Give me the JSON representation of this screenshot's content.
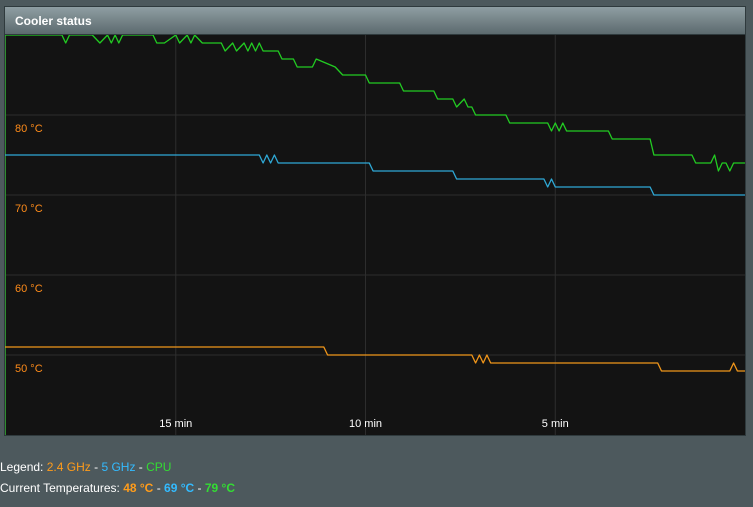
{
  "panel": {
    "title": "Cooler status"
  },
  "legend": {
    "label": "Legend:",
    "sep": "-",
    "items": [
      "2.4 GHz",
      "5 GHz",
      "CPU"
    ]
  },
  "current": {
    "label": "Current Temperatures:",
    "sep": "-",
    "values": [
      "48 °C",
      "69 °C",
      "79 °C"
    ]
  },
  "colors": {
    "ghz24": "#f0961a",
    "ghz5": "#2fa9d6",
    "cpu": "#22cc22",
    "grid": "#2e2e2e",
    "axis_label": "#ff8c1a"
  },
  "chart_data": {
    "type": "line",
    "y_ticks": [
      "80 °C",
      "70 °C",
      "60 °C",
      "50 °C"
    ],
    "y_tick_values": [
      80,
      70,
      60,
      50
    ],
    "x_ticks": [
      "15 min",
      "10 min",
      "5 min"
    ],
    "x_tick_values": [
      -15,
      -10,
      -5
    ],
    "xlim": [
      -19.5,
      0
    ],
    "ylim": [
      40,
      90
    ],
    "series": [
      {
        "name": "CPU",
        "color": "#22cc22",
        "x": [
          -19.5,
          -18.0,
          -17.9,
          -17.8,
          -17.6,
          -17.2,
          -17.0,
          -16.8,
          -16.7,
          -16.6,
          -16.5,
          -16.4,
          -16.3,
          -16.2,
          -15.7,
          -15.6,
          -15.5,
          -15.3,
          -15.0,
          -14.9,
          -14.7,
          -14.6,
          -14.5,
          -14.3,
          -14.2,
          -14.1,
          -13.9,
          -13.8,
          -13.7,
          -13.5,
          -13.4,
          -13.2,
          -13.1,
          -13.0,
          -12.9,
          -12.8,
          -12.7,
          -12.6,
          -12.4,
          -12.3,
          -12.2,
          -12.1,
          -11.9,
          -11.8,
          -11.4,
          -11.3,
          -10.8,
          -10.6,
          -10.0,
          -9.9,
          -9.1,
          -9.0,
          -8.2,
          -8.1,
          -7.7,
          -7.6,
          -7.4,
          -7.3,
          -7.2,
          -7.1,
          -6.3,
          -6.2,
          -5.2,
          -5.1,
          -5.0,
          -4.9,
          -4.8,
          -4.7,
          -3.6,
          -3.5,
          -2.5,
          -2.4,
          -1.4,
          -1.3,
          -0.9,
          -0.8,
          -0.7,
          -0.6,
          -0.5,
          -0.4,
          -0.3,
          -0.2,
          0
        ],
        "y": [
          90,
          90,
          89,
          90,
          90,
          90,
          89,
          90,
          89,
          90,
          89,
          90,
          90,
          90,
          90,
          90,
          89,
          89,
          90,
          89,
          90,
          89,
          90,
          89,
          89,
          89,
          89,
          89,
          88,
          89,
          88,
          89,
          88,
          89,
          88,
          89,
          88,
          88,
          88,
          88,
          87,
          87,
          87,
          86,
          86,
          87,
          86,
          85,
          85,
          84,
          84,
          83,
          83,
          82,
          82,
          81,
          82,
          81,
          81,
          80,
          80,
          79,
          79,
          78,
          79,
          78,
          79,
          78,
          78,
          77,
          77,
          75,
          75,
          74,
          74,
          75,
          73,
          74,
          74,
          73,
          74,
          74,
          74
        ]
      },
      {
        "name": "5 GHz",
        "color": "#2fa9d6",
        "x": [
          -19.5,
          -12.8,
          -12.7,
          -12.6,
          -12.5,
          -12.4,
          -12.3,
          -12.2,
          -9.9,
          -9.8,
          -7.7,
          -7.6,
          -5.3,
          -5.2,
          -5.1,
          -5.0,
          -2.5,
          -2.4,
          0
        ],
        "y": [
          75,
          75,
          74,
          75,
          74,
          75,
          74,
          74,
          74,
          73,
          73,
          72,
          72,
          71,
          72,
          71,
          71,
          70,
          70
        ]
      },
      {
        "name": "2.4 GHz",
        "color": "#f0961a",
        "x": [
          -19.5,
          -11.1,
          -11.0,
          -7.2,
          -7.1,
          -7.0,
          -6.9,
          -6.8,
          -6.7,
          -6.6,
          -2.3,
          -2.2,
          -0.4,
          -0.3,
          -0.2,
          0
        ],
        "y": [
          51,
          51,
          50,
          50,
          49,
          50,
          49,
          50,
          49,
          49,
          49,
          48,
          48,
          49,
          48,
          48
        ]
      }
    ]
  }
}
